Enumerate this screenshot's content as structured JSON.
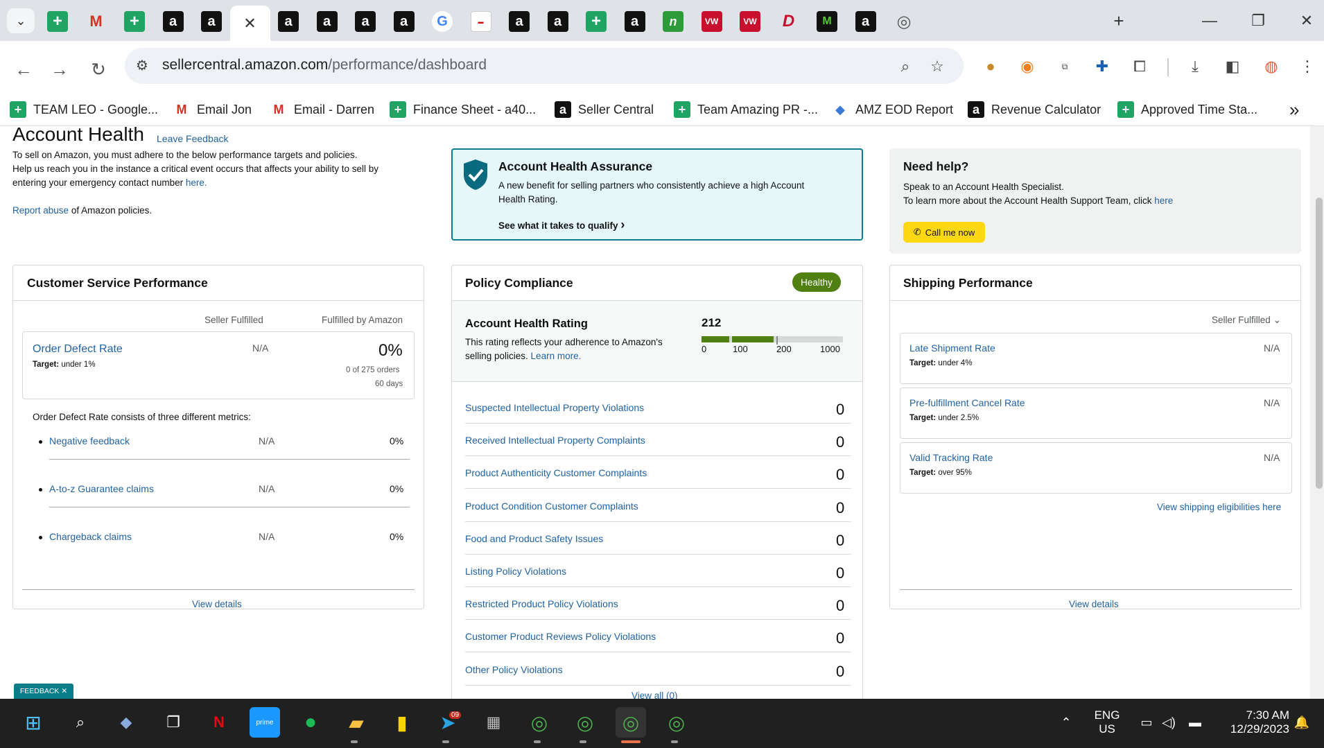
{
  "browser": {
    "url_host": "sellercentral.amazon.com",
    "url_path": "/performance/dashboard",
    "tabs": [
      {
        "icon": "sheets-icon",
        "glyph": "+"
      },
      {
        "icon": "gmail-icon",
        "glyph": "M"
      },
      {
        "icon": "sheets-icon",
        "glyph": "+"
      },
      {
        "icon": "amazon-icon",
        "glyph": "a"
      },
      {
        "icon": "amazon-icon",
        "glyph": "a"
      },
      {
        "icon": "close-icon",
        "glyph": "✕",
        "active": true
      },
      {
        "icon": "amazon-icon",
        "glyph": "a"
      },
      {
        "icon": "amazon-icon",
        "glyph": "a"
      },
      {
        "icon": "amazon-icon",
        "glyph": "a"
      },
      {
        "icon": "amazon-smile-icon",
        "glyph": "a"
      },
      {
        "icon": "google-icon",
        "glyph": "G"
      },
      {
        "icon": "white-page-icon",
        "glyph": "▬"
      },
      {
        "icon": "amazon-smile-icon",
        "glyph": "a"
      },
      {
        "icon": "amazon-smile-icon",
        "glyph": "a"
      },
      {
        "icon": "sheets-icon",
        "glyph": "+"
      },
      {
        "icon": "amazon-smile-icon",
        "glyph": "a"
      },
      {
        "icon": "green-n-icon",
        "glyph": "n"
      },
      {
        "icon": "vw-icon",
        "glyph": "VW"
      },
      {
        "icon": "vw-icon",
        "glyph": "VW"
      },
      {
        "icon": "d-icon",
        "glyph": "D"
      },
      {
        "icon": "m-icon",
        "glyph": "M"
      },
      {
        "icon": "amazon-icon",
        "glyph": "a"
      },
      {
        "icon": "chrome-icon",
        "glyph": "◎"
      }
    ],
    "bookmarks": [
      {
        "label": "TEAM LEO - Google...",
        "icon": "sheets-icon",
        "glyph": "+"
      },
      {
        "label": "Email Jon",
        "icon": "gmail-icon",
        "glyph": "M"
      },
      {
        "label": "Email - Darren",
        "icon": "gmail-icon",
        "glyph": "M"
      },
      {
        "label": "Finance Sheet - a40...",
        "icon": "sheets-icon",
        "glyph": "+"
      },
      {
        "label": "Seller Central",
        "icon": "amazon-icon",
        "glyph": "a"
      },
      {
        "label": "Team Amazing PR -...",
        "icon": "sheets-icon",
        "glyph": "+"
      },
      {
        "label": "AMZ EOD Report",
        "icon": "report-icon",
        "glyph": "◆"
      },
      {
        "label": "Revenue Calculator",
        "icon": "amazon-icon",
        "glyph": "a"
      },
      {
        "label": "Approved Time Sta...",
        "icon": "sheets-icon",
        "glyph": "+"
      }
    ],
    "more_bookmarks": "»"
  },
  "header": {
    "title": "Account Health",
    "leave_feedback": "Leave Feedback",
    "intro_line1": "To sell on Amazon, you must adhere to the below performance targets and policies.",
    "intro_line2": "Help us reach you in the instance a critical event occurs that affects your ability to sell by",
    "intro_line3_pre": "entering your emergency contact number ",
    "intro_line3_link": "here.",
    "report_link": "Report abuse",
    "report_rest": " of Amazon policies."
  },
  "assurance": {
    "title": "Account Health Assurance",
    "desc_line1": "A new benefit for selling partners who consistently achieve a high Account",
    "desc_line2": "Health Rating.",
    "cta": "See what it takes to qualify",
    "cta_chevron": "›"
  },
  "help": {
    "title": "Need help?",
    "line1": "Speak to an Account Health Specialist.",
    "line2_pre": "To learn more about the Account Health Support Team, click ",
    "line2_link": "here",
    "call_button": "Call me now"
  },
  "customer_service": {
    "title": "Customer Service Performance",
    "col_seller": "Seller Fulfilled",
    "col_fba": "Fulfilled by Amazon",
    "odr_label": "Order Defect Rate",
    "odr_target_label": "Target:",
    "odr_target": " under 1%",
    "odr_seller": "N/A",
    "odr_fba": "0%",
    "odr_orders": "0 of 275 orders",
    "odr_days": "60 days",
    "consists": "Order Defect Rate consists of three different metrics:",
    "metrics": [
      {
        "label": "Negative feedback",
        "seller": "N/A",
        "fba": "0%"
      },
      {
        "label": "A-to-z Guarantee claims",
        "seller": "N/A",
        "fba": "0%"
      },
      {
        "label": "Chargeback claims",
        "seller": "N/A",
        "fba": "0%"
      }
    ],
    "view_details": "View details"
  },
  "policy": {
    "title": "Policy Compliance",
    "badge": "Healthy",
    "ahr_title": "Account Health Rating",
    "ahr_desc1": "This rating reflects your adherence to Amazon's",
    "ahr_desc2_pre": "selling policies. ",
    "ahr_desc2_link": "Learn more.",
    "rating": "212",
    "scale": [
      "0",
      "100",
      "200",
      "1000"
    ],
    "items": [
      {
        "label": "Suspected Intellectual Property Violations",
        "count": "0"
      },
      {
        "label": "Received Intellectual Property Complaints",
        "count": "0"
      },
      {
        "label": "Product Authenticity Customer Complaints",
        "count": "0"
      },
      {
        "label": "Product Condition Customer Complaints",
        "count": "0"
      },
      {
        "label": "Food and Product Safety Issues",
        "count": "0"
      },
      {
        "label": "Listing Policy Violations",
        "count": "0"
      },
      {
        "label": "Restricted Product Policy Violations",
        "count": "0"
      },
      {
        "label": "Customer Product Reviews Policy Violations",
        "count": "0"
      },
      {
        "label": "Other Policy Violations",
        "count": "0"
      }
    ],
    "view_all": "View all (0)"
  },
  "shipping": {
    "title": "Shipping Performance",
    "filter": "Seller Fulfilled",
    "filter_chevron": "⌄",
    "metrics": [
      {
        "label": "Late Shipment Rate",
        "target_label": "Target:",
        "target": " under 4%",
        "value": "N/A"
      },
      {
        "label": "Pre-fulfillment Cancel Rate",
        "target_label": "Target:",
        "target": " under 2.5%",
        "value": "N/A"
      },
      {
        "label": "Valid Tracking Rate",
        "target_label": "Target:",
        "target": " over 95%",
        "value": "N/A"
      }
    ],
    "eligibility_link": "View shipping eligibilities here",
    "view_details": "View details"
  },
  "feedback_tab": "FEEDBACK ✕",
  "taskbar": {
    "lang1": "ENG",
    "lang2": "US",
    "time": "7:30 AM",
    "date": "12/29/2023",
    "telegram_badge": "09"
  },
  "colors": {
    "link": "#2162a1",
    "healthy": "#507f12",
    "assurance_bg": "#e6f7fa",
    "assurance_border": "#0a7d8a",
    "call_button": "#ffd814"
  }
}
